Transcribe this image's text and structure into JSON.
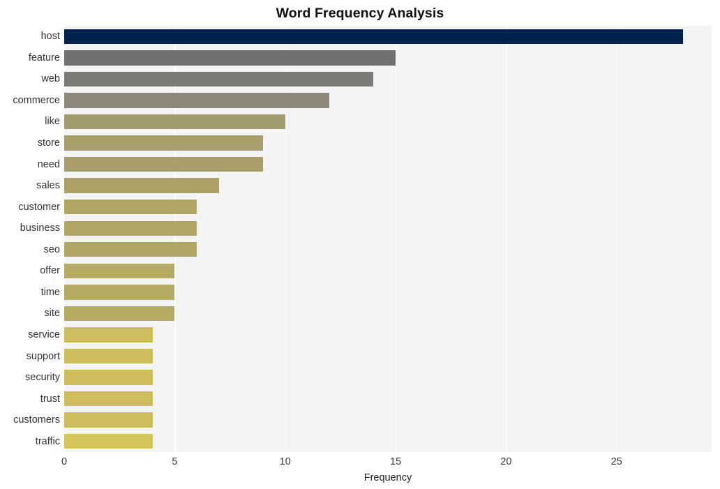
{
  "chart_data": {
    "type": "bar",
    "orientation": "horizontal",
    "title": "Word Frequency Analysis",
    "xlabel": "Frequency",
    "ylabel": "",
    "xlim": [
      0,
      29.3
    ],
    "ylim": null,
    "grid": true,
    "legend": null,
    "xticks": [
      "0",
      "5",
      "10",
      "15",
      "20",
      "25"
    ],
    "xtick_values": [
      0,
      5,
      10,
      15,
      20,
      25
    ],
    "categories": [
      "host",
      "feature",
      "web",
      "commerce",
      "like",
      "store",
      "need",
      "sales",
      "customer",
      "business",
      "seo",
      "offer",
      "time",
      "site",
      "service",
      "support",
      "security",
      "trust",
      "customers",
      "traffic"
    ],
    "values": [
      28,
      15,
      14,
      12,
      10,
      9,
      9,
      7,
      6,
      6,
      6,
      5,
      5,
      5,
      4,
      4,
      4,
      4,
      4,
      4
    ],
    "bar_colors": [
      "#00234d",
      "#717171",
      "#7b7b77",
      "#8d8877",
      "#a29b70",
      "#a89f6c",
      "#a89f6c",
      "#ab a167",
      "#b0a665",
      "#b0a665",
      "#b0a665",
      "#b5aa62",
      "#b5aa62",
      "#b5aa62",
      "#cdbd5e",
      "#cdbd5e",
      "#cdbd5e",
      "#cdbd5e",
      "#cdbd5e",
      "#d4c45c"
    ],
    "plot_background": "#f4f4f4",
    "gridline_color": "#ffffff",
    "figure_background": "#ffffff"
  },
  "colors": {
    "accent_max": "#00234d",
    "accent_min": "#d4c45c",
    "text": "#333333",
    "title": "#111111"
  }
}
